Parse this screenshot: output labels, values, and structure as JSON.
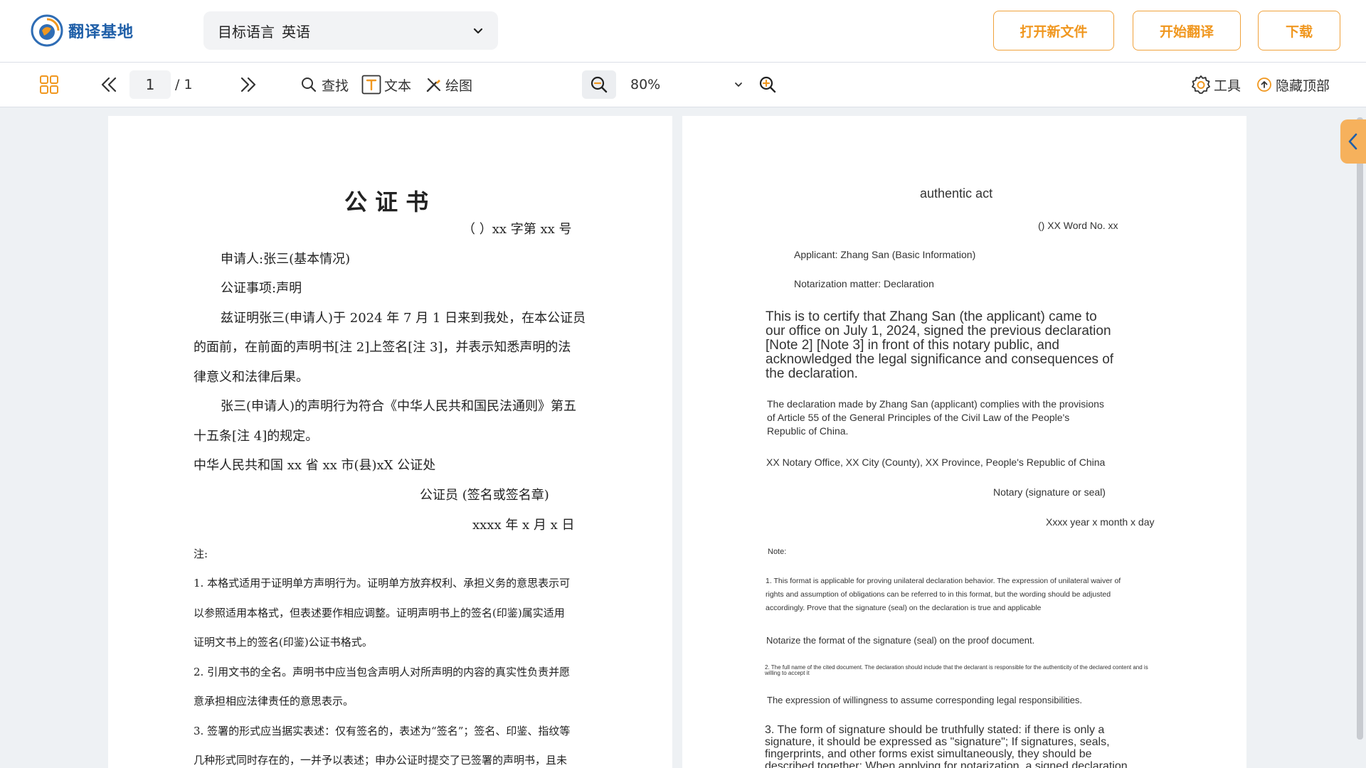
{
  "app": {
    "logo_text": "翻译基地"
  },
  "header": {
    "target_lang_label": "目标语言",
    "target_lang_value": "英语",
    "open_file_label": "打开新文件",
    "start_translate_label": "开始翻译",
    "download_label": "下载"
  },
  "toolbar": {
    "current_page": "1",
    "total_pages": "/ 1",
    "find_label": "查找",
    "text_label": "文本",
    "draw_label": "绘图",
    "zoom_value": "80%",
    "tools_label": "工具",
    "hide_top_label": "隐藏顶部"
  },
  "source_doc": {
    "title": "公 证 书",
    "ref_no": "（     ）xx 字第 xx 号",
    "applicant": "申请人:张三(基本情况)",
    "matter": "公证事项:声明",
    "body1_line1": "兹证明张三(申请人)于 2024 年 7 月 1 日来到我处，在本公证员",
    "body1_line2": "的面前，在前面的声明书[注 2]上签名[注 3]，并表示知悉声明的法",
    "body1_line3": "律意义和法律后果。",
    "body2_line1": "张三(申请人)的声明行为符合《中华人民共和国民法通则》第五",
    "body2_line2": "十五条[注 4]的规定。",
    "office": "中华人民共和国 xx 省 xx 市(县)xX 公证处",
    "notary": "公证员     (签名或签名章)",
    "date": "xxxx 年 x 月 x 日",
    "note_label": "注:",
    "note1_line1": "1. 本格式适用于证明单方声明行为。证明单方放弃权利、承担义务的意思表示可",
    "note1_line2": "以参照适用本格式，但表述要作相应调整。证明声明书上的签名(印鉴)属实适用",
    "note1_line3": "证明文书上的签名(印鉴)公证书格式。",
    "note2_line1": "2. 引用文书的全名。声明书中应当包含声明人对所声明的内容的真实性负责并愿",
    "note2_line2": "意承担相应法律责任的意思表示。",
    "note3_line1": "3. 签署的形式应当据实表述：仅有签名的，表述为“签名”；签名、印鉴、指纹等",
    "note3_line2": "几种形式同时存在的，一并予以表述；申办公证时提交了已签署的声明书，且未"
  },
  "translated_doc": {
    "title": "authentic act",
    "ref_no": "() XX Word No. xx",
    "applicant": "Applicant: Zhang San (Basic Information)",
    "matter": "Notarization matter: Declaration",
    "body1_line1": "This is to certify that Zhang San (the applicant) came to",
    "body1_line2": "our office on July 1, 2024, signed the previous declaration",
    "body1_line3": "[Note 2] [Note 3] in front of this notary public, and",
    "body1_line4": "acknowledged the legal significance and consequences of",
    "body1_line5": "the declaration.",
    "body2_line1": "The declaration made by Zhang San (applicant) complies with the provisions",
    "body2_line2": "of Article 55 of the General Principles of the Civil Law of the People's",
    "body2_line3": "Republic of China.",
    "office": "XX Notary Office, XX City (County), XX Province, People's Republic of China",
    "notary": "Notary (signature or seal)",
    "date": "Xxxx year x month x day",
    "note_label": "Note:",
    "note1_line1": "1. This format is applicable for proving unilateral declaration behavior. The expression of unilateral waiver of",
    "note1_line2": "rights and assumption of obligations can be referred to in this format, but the wording should be adjusted",
    "note1_line3": "accordingly. Prove that the signature (seal) on the declaration is true and applicable",
    "note1b": "Notarize the format of the signature (seal) on the proof document.",
    "note2_line1": "2. The full name of the cited document. The declaration should include that the declarant is responsible for the authenticity of the declared content and is",
    "note2_line2": "willing to accept it",
    "note2b": "The expression of willingness to assume corresponding legal responsibilities.",
    "note3_line1": "3. The form of signature should be truthfully stated: if there is only a",
    "note3_line2": "signature, it should be expressed as \"signature\"; If signatures, seals,",
    "note3_line3": "fingerprints, and other forms exist simultaneously, they should be",
    "note3_line4": "described together; When applying for notarization, a signed declaration"
  },
  "colors": {
    "accent": "#f0971f",
    "brand": "#1f5fa8"
  }
}
